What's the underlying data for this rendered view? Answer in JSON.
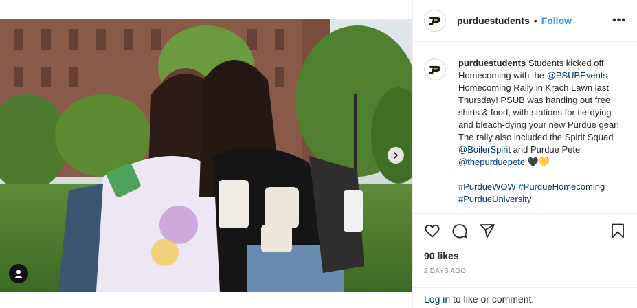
{
  "post": {
    "username": "purduestudents",
    "follow_label": "Follow",
    "separator": "•",
    "more_label": "•••"
  },
  "caption": {
    "username": "purduestudents",
    "text_1": " Students kicked off Homecoming with the ",
    "mention_1": "@PSUBEvents",
    "text_2": " Homecoming Rally in Krach Lawn last Thursday! PSUB was handing out free shirts & food, with stations for tie-dying and bleach-dying your new Purdue gear! The rally also included the Spirit Squad ",
    "mention_2": "@BoilerSpirit",
    "text_3": " and Purdue Pete ",
    "mention_3": "@thepurduepete",
    "emoji": " 🖤💛",
    "hashtag_1": "#PurdueWOW",
    "hashtag_2": "#PurdueHomecoming",
    "hashtag_3": "#PurdueUniversity"
  },
  "engagement": {
    "likes": "90 likes",
    "date": "2 DAYS AGO"
  },
  "login": {
    "link": "Log in",
    "rest": " to like or comment."
  },
  "icons": {
    "like": "heart-icon",
    "comment": "comment-icon",
    "share": "share-icon",
    "save": "bookmark-icon",
    "next": "chevron-right-icon",
    "tags": "user-tag-icon"
  },
  "colors": {
    "link_blue": "#3897f0",
    "mention_blue": "#00376b",
    "muted": "#8e8e8e"
  }
}
